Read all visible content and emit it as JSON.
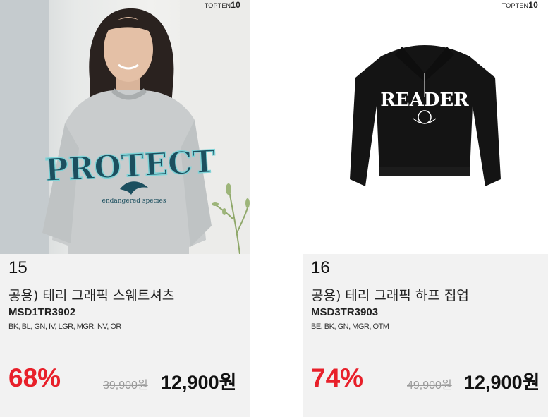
{
  "products": [
    {
      "brand": "TOPTEN",
      "brand_num": "10",
      "rank": "15",
      "name": "공용) 테리 그래픽 스웨트셔츠",
      "code": "MSD1TR3902",
      "colors": "BK, BL, GN, IV, LGR, MGR, NV, OR",
      "discount": "68%",
      "original_price": "39,900원",
      "sale_price": "12,900원",
      "graphic_text": "PROTECT",
      "graphic_subtext": "endangered species"
    },
    {
      "brand": "TOPTEN",
      "brand_num": "10",
      "rank": "16",
      "name": "공용) 테리 그래픽 하프 집업",
      "code": "MSD3TR3903",
      "colors": "BE, BK, GN, MGR, OTM",
      "discount": "74%",
      "original_price": "49,900원",
      "sale_price": "12,900원",
      "graphic_text": "READER"
    }
  ],
  "colors": {
    "discount": "#e8202a",
    "card_bg": "#f2f2f2",
    "sweat_gray": "#c9cccd",
    "print_teal": "#1c4f5f",
    "zipup_black": "#141414"
  }
}
